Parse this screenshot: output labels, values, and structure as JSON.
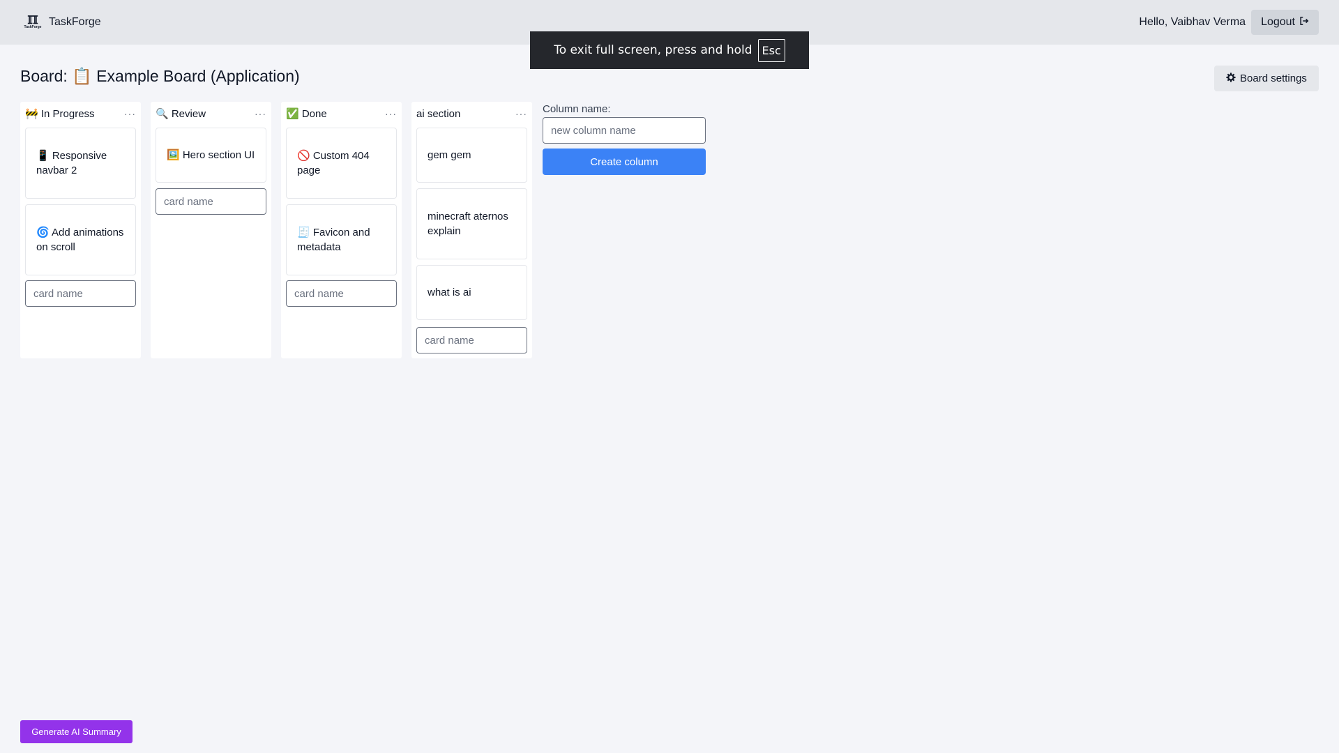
{
  "header": {
    "brand_name": "TaskForge",
    "logo_text": "TaskForge",
    "greeting": "Hello, Vaibhav Verma",
    "logout_label": "Logout"
  },
  "fullscreen_toast": {
    "message": "To exit full screen, press and hold",
    "key": "Esc"
  },
  "board": {
    "title": "Board: 📋 Example Board (Application)",
    "settings_label": "Board settings"
  },
  "columns": [
    {
      "title": "🚧 In Progress",
      "cards": [
        "📱 Responsive navbar 2",
        "🌀 Add animations on scroll"
      ],
      "input_placeholder": "card name"
    },
    {
      "title": "🔍 Review",
      "cards": [
        "🖼️ Hero section UI"
      ],
      "input_placeholder": "card name"
    },
    {
      "title": "✅ Done",
      "cards": [
        "🚫 Custom 404 page",
        "🧾 Favicon and metadata"
      ],
      "input_placeholder": "card name"
    },
    {
      "title": "ai section",
      "cards": [
        "gem gem",
        "minecraft aternos explain",
        "what is ai"
      ],
      "input_placeholder": "card name"
    }
  ],
  "new_column": {
    "label": "Column name:",
    "placeholder": "new column name",
    "button_label": "Create column"
  },
  "ai_summary": {
    "button_label": "Generate AI Summary"
  },
  "colors": {
    "primary_button": "#3b82f6",
    "ai_button": "#9333ea",
    "header_bg": "#e5e7eb",
    "page_bg": "#f4f5f9"
  }
}
